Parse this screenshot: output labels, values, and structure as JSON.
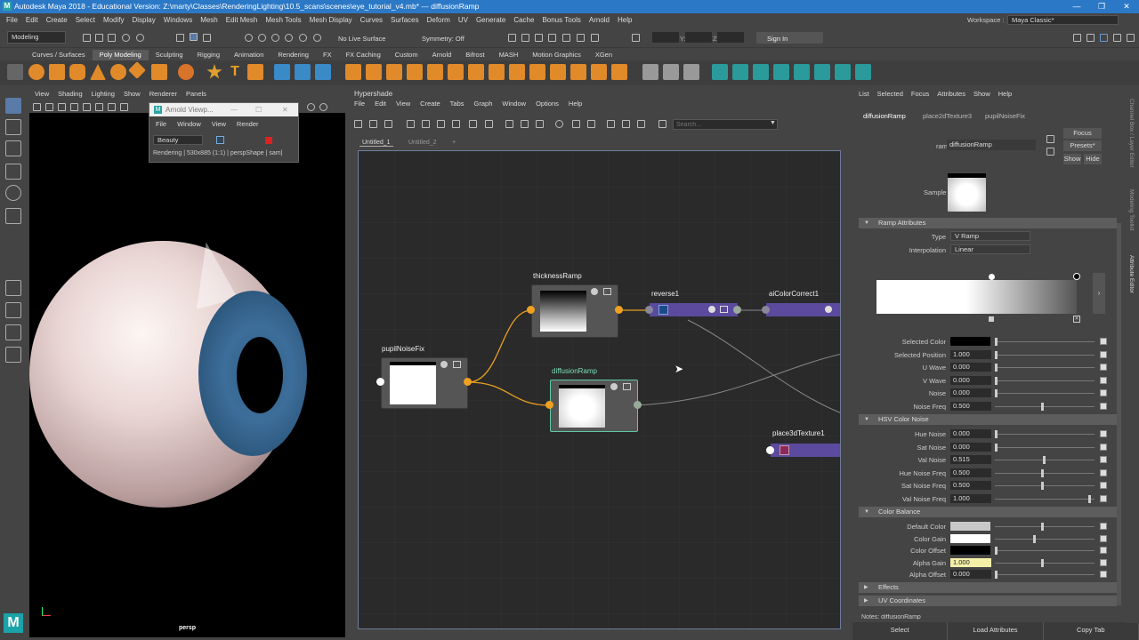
{
  "window": {
    "title": "Autodesk Maya 2018 - Educational Version: Z:\\marty\\Classes\\RenderingLighting\\10.5_scans\\scenes\\eye_tutorial_v4.mb*  ---  diffusionRamp",
    "maya_icon": "M"
  },
  "menubar": [
    "File",
    "Edit",
    "Create",
    "Select",
    "Modify",
    "Display",
    "Windows",
    "Mesh",
    "Edit Mesh",
    "Mesh Tools",
    "Mesh Display",
    "Curves",
    "Surfaces",
    "Deform",
    "UV",
    "Generate",
    "Cache",
    "Bonus Tools",
    "Arnold",
    "Help"
  ],
  "workspace": {
    "label": "Workspace :",
    "value": "Maya Classic*"
  },
  "statusline": {
    "mode": "Modeling",
    "live_surface": "No Live Surface",
    "symmetry": "Symmetry: Off",
    "x": "X:",
    "y": "Y:",
    "z": "Z:",
    "sign_in": "Sign In"
  },
  "shelf_tabs": [
    "Curves / Surfaces",
    "Poly Modeling",
    "Sculpting",
    "Rigging",
    "Animation",
    "Rendering",
    "FX",
    "FX Caching",
    "Custom",
    "Arnold",
    "Bifrost",
    "MASH",
    "Motion Graphics",
    "XGen"
  ],
  "shelf_active": "Poly Modeling",
  "viewport": {
    "menu": [
      "View",
      "Shading",
      "Lighting",
      "Show",
      "Renderer",
      "Panels"
    ],
    "camera_label": "persp"
  },
  "arnold_viewer": {
    "title": "Arnold Viewp...",
    "menu": [
      "File",
      "Window",
      "View",
      "Render"
    ],
    "aov": "Beauty",
    "status": "Rendering | 530x885 (1:1) | perspShape  | sam|"
  },
  "hypershade": {
    "title": "Hypershade",
    "menu": [
      "File",
      "Edit",
      "View",
      "Create",
      "Tabs",
      "Graph",
      "Window",
      "Options",
      "Help"
    ],
    "search_placeholder": "Search...",
    "tabs": [
      "Untitled_1",
      "Untitled_2",
      "+"
    ],
    "nodes": {
      "thickness": "thicknessRamp",
      "reverse": "reverse1",
      "colorcorrect": "aiColorCorrect1",
      "pupil": "pupilNoiseFix",
      "diffusion": "diffusionRamp",
      "place3d": "place3dTexture1"
    }
  },
  "attr_editor": {
    "menu": [
      "List",
      "Selected",
      "Focus",
      "Attributes",
      "Show",
      "Help"
    ],
    "tabs": [
      "diffusionRamp",
      "place2dTexture3",
      "pupilNoiseFix"
    ],
    "ramp_label": "ramp:",
    "ramp_value": "diffusionRamp",
    "focus": "Focus",
    "presets": "Presets*",
    "show": "Show",
    "hide": "Hide",
    "sample_label": "Sample",
    "sections": {
      "ramp": "Ramp Attributes",
      "hsv": "HSV Color Noise",
      "color_balance": "Color Balance",
      "effects": "Effects",
      "uv": "UV Coordinates"
    },
    "type_label": "Type",
    "type_value": "V Ramp",
    "interp_label": "Interpolation",
    "interp_value": "Linear",
    "ramp_attrs": [
      {
        "label": "Selected Color",
        "value": ""
      },
      {
        "label": "Selected Position",
        "value": "1.000"
      },
      {
        "label": "U Wave",
        "value": "0.000"
      },
      {
        "label": "V Wave",
        "value": "0.000"
      },
      {
        "label": "Noise",
        "value": "0.000"
      },
      {
        "label": "Noise Freq",
        "value": "0.500"
      }
    ],
    "hsv_attrs": [
      {
        "label": "Hue Noise",
        "value": "0.000"
      },
      {
        "label": "Sat Noise",
        "value": "0.000"
      },
      {
        "label": "Val Noise",
        "value": "0.515"
      },
      {
        "label": "Hue Noise Freq",
        "value": "0.500"
      },
      {
        "label": "Sat Noise Freq",
        "value": "0.500"
      },
      {
        "label": "Val Noise Freq",
        "value": "1.000"
      }
    ],
    "cb_attrs": [
      {
        "label": "Default Color",
        "value": ""
      },
      {
        "label": "Color Gain",
        "value": ""
      },
      {
        "label": "Color Offset",
        "value": ""
      },
      {
        "label": "Alpha Gain",
        "value": "1.000"
      },
      {
        "label": "Alpha Offset",
        "value": "0.000"
      }
    ],
    "notes": "Notes:  diffusionRamp",
    "bottom_buttons": [
      "Select",
      "Load Attributes",
      "Copy Tab"
    ]
  },
  "side_tabs": [
    "Channel Box / Layer Editor",
    "Modeling Toolkit",
    "Attribute Editor"
  ],
  "colors": {
    "title_bar": "#2b78c6",
    "node_bar": "#5b4a9e",
    "connection": "#e8a020",
    "selected_node": "#5ec8a0"
  }
}
